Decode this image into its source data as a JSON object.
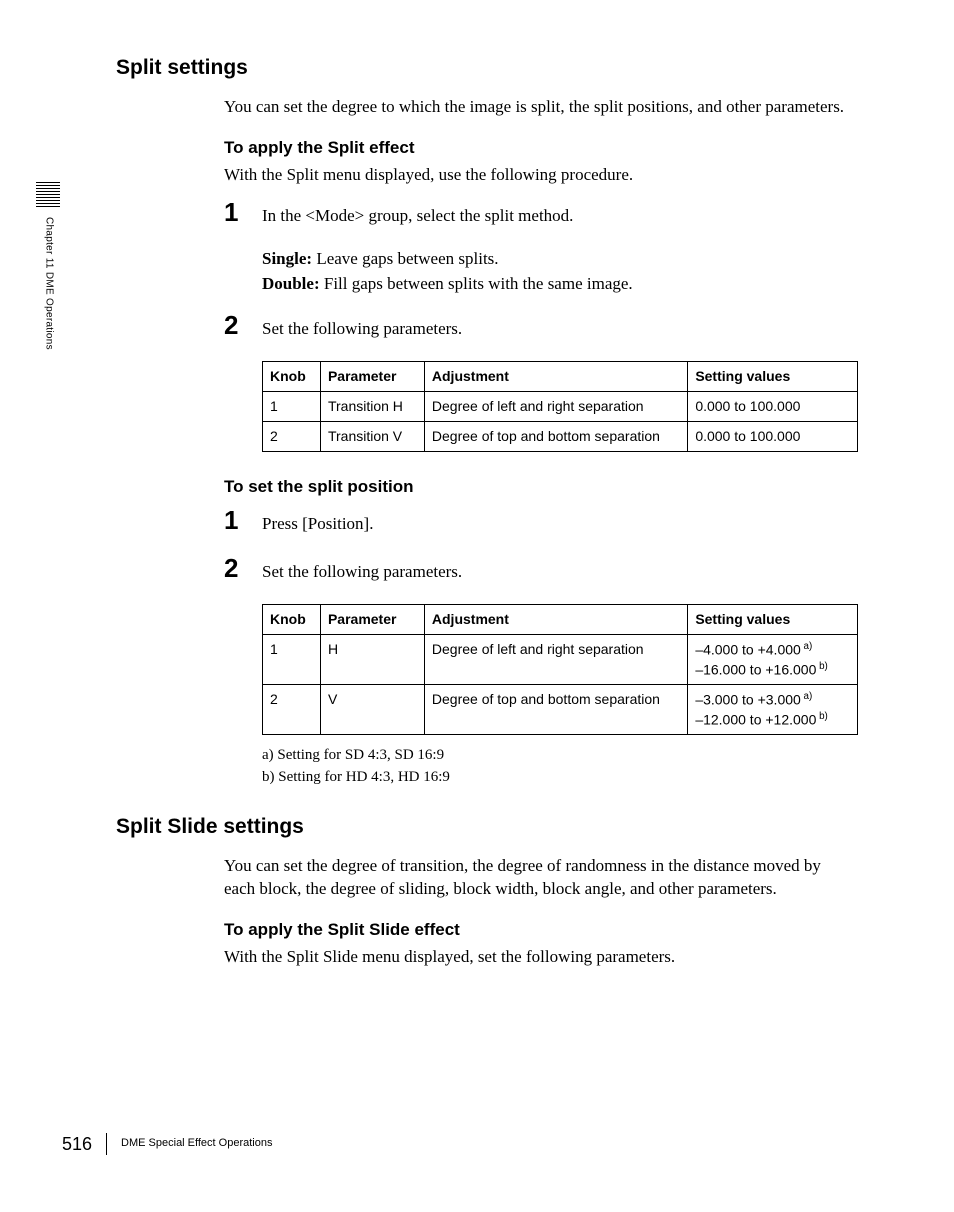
{
  "side": {
    "chapter_text": "Chapter 11  DME Operations"
  },
  "section1": {
    "heading": "Split settings",
    "intro": "You can set the degree to which the image is split, the split positions, and other parameters.",
    "sub1": {
      "heading": "To apply the Split effect",
      "lead": "With the Split menu displayed, use the following procedure.",
      "step1_num": "1",
      "step1_text": "In the <Mode> group, select the split method.",
      "mode_single_label": "Single:",
      "mode_single_text": " Leave gaps between splits.",
      "mode_double_label": "Double:",
      "mode_double_text": " Fill gaps between splits with the same image.",
      "step2_num": "2",
      "step2_text": "Set the following parameters.",
      "table": {
        "headers": {
          "knob": "Knob",
          "parameter": "Parameter",
          "adjustment": "Adjustment",
          "setting": "Setting values"
        },
        "row1": {
          "knob": "1",
          "parameter": "Transition H",
          "adjustment": "Degree of left and right separation",
          "setting": "0.000 to 100.000"
        },
        "row2": {
          "knob": "2",
          "parameter": "Transition V",
          "adjustment": "Degree of top and bottom separation",
          "setting": "0.000 to 100.000"
        }
      }
    },
    "sub2": {
      "heading": "To set the split position",
      "step1_num": "1",
      "step1_text": "Press [Position].",
      "step2_num": "2",
      "step2_text": "Set the following parameters.",
      "table": {
        "headers": {
          "knob": "Knob",
          "parameter": "Parameter",
          "adjustment": "Adjustment",
          "setting": "Setting values"
        },
        "row1": {
          "knob": "1",
          "parameter": "H",
          "adjustment": "Degree of left and right separation",
          "setting_line1": "–4.000 to +4.000",
          "setting_sup1": " a)",
          "setting_line2": "–16.000 to +16.000",
          "setting_sup2": " b)"
        },
        "row2": {
          "knob": "2",
          "parameter": "V",
          "adjustment": "Degree of top and bottom separation",
          "setting_line1": "–3.000 to +3.000",
          "setting_sup1": " a)",
          "setting_line2": "–12.000 to +12.000",
          "setting_sup2": " b)"
        }
      },
      "footnote_a": "a) Setting for SD 4:3, SD 16:9",
      "footnote_b": "b) Setting for HD 4:3, HD 16:9"
    }
  },
  "section2": {
    "heading": "Split Slide settings",
    "intro": "You can set the degree of transition, the degree of randomness in the distance moved by each block, the degree of sliding, block width, block angle, and other parameters.",
    "sub1": {
      "heading": "To apply the Split Slide effect",
      "lead": "With the Split Slide menu displayed, set the following parameters."
    }
  },
  "footer": {
    "page": "516",
    "title": "DME Special Effect Operations"
  }
}
